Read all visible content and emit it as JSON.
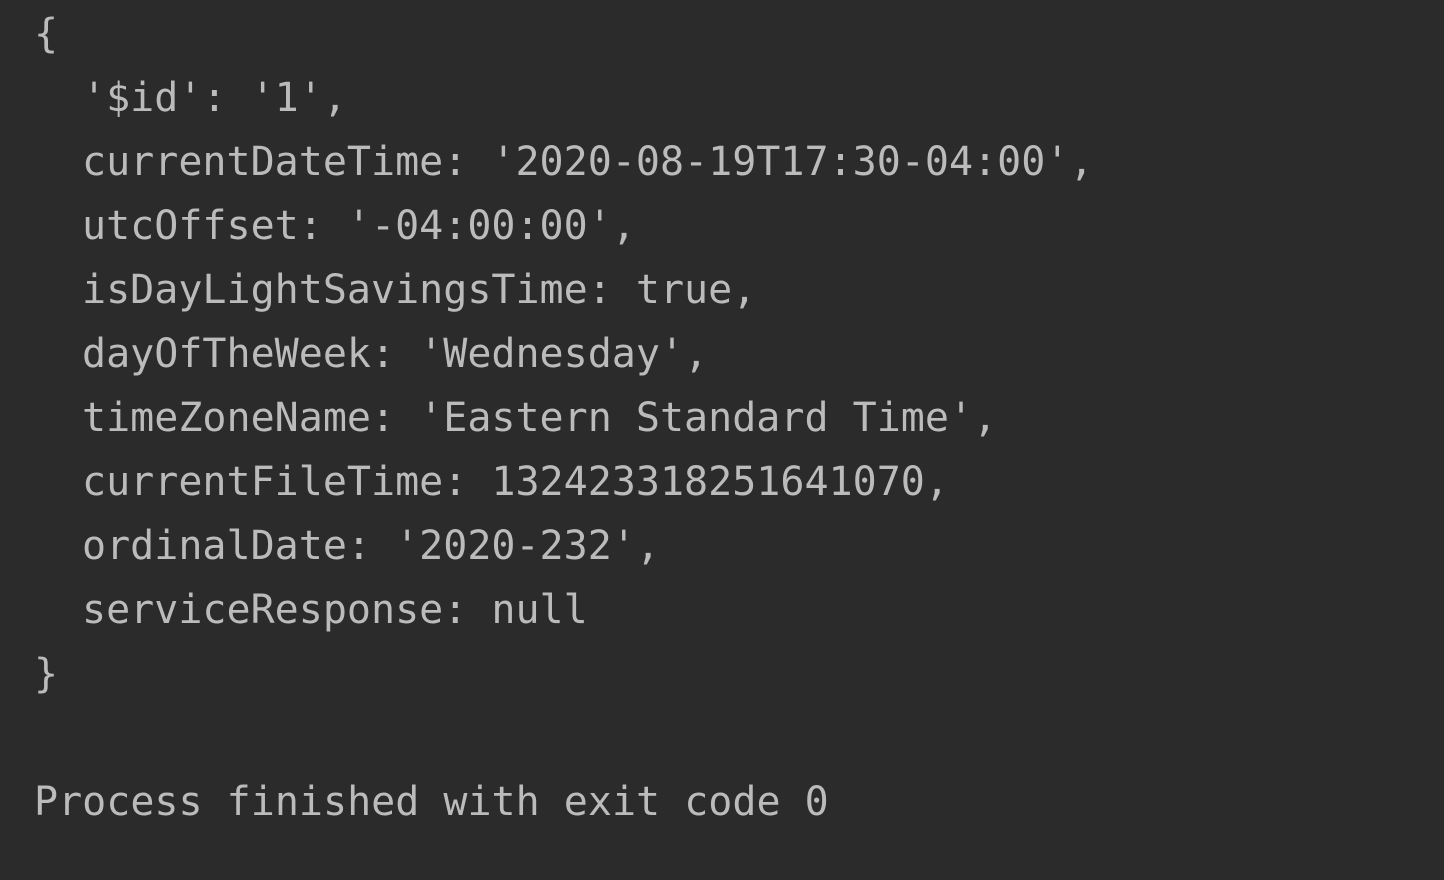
{
  "console": {
    "open_brace": "{",
    "lines": [
      "'$id': '1',",
      "currentDateTime: '2020-08-19T17:30-04:00',",
      "utcOffset: '-04:00:00',",
      "isDayLightSavingsTime: true,",
      "dayOfTheWeek: 'Wednesday',",
      "timeZoneName: 'Eastern Standard Time',",
      "currentFileTime: 132423318251641070,",
      "ordinalDate: '2020-232',",
      "serviceResponse: null"
    ],
    "close_brace": "}",
    "process_status": "Process finished with exit code 0"
  },
  "colors": {
    "background": "#2b2b2b",
    "text": "#bbbbbb"
  }
}
